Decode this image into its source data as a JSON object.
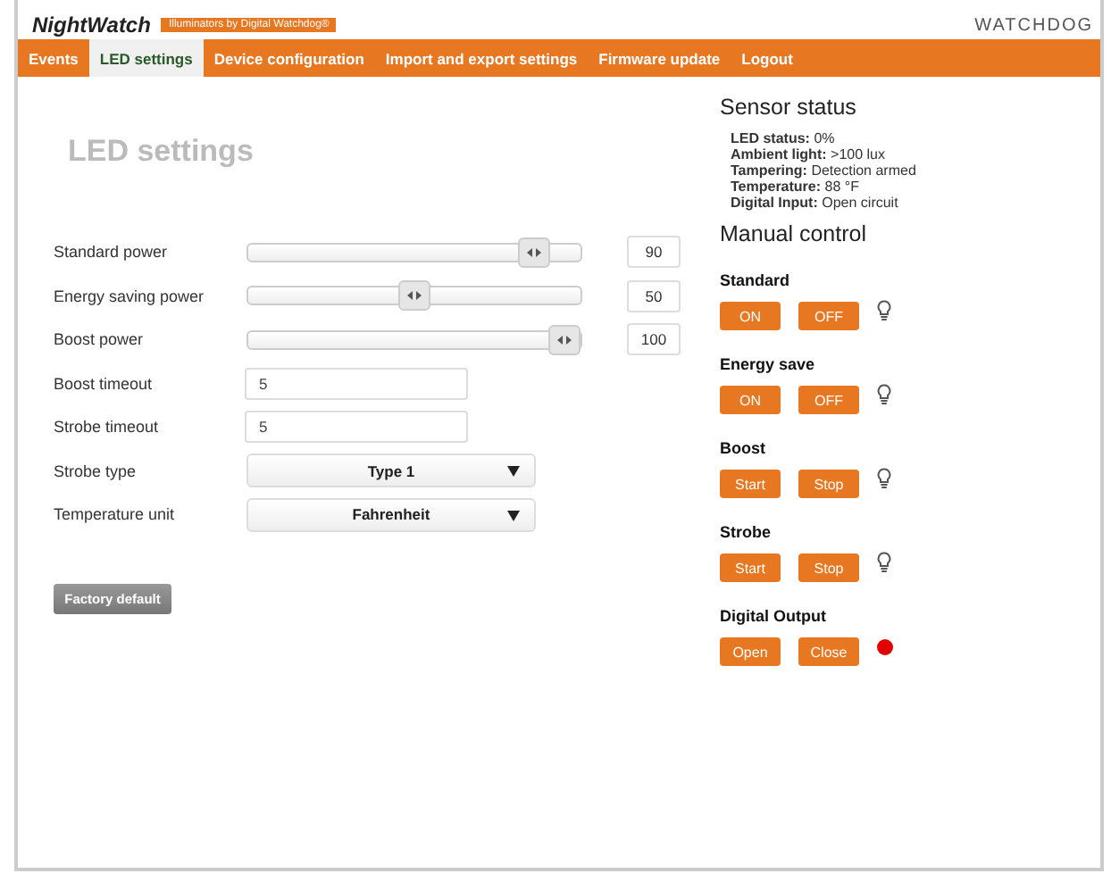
{
  "logo": {
    "name": "NightWatch",
    "tagline": "Illuminators by Digital Watchdog®"
  },
  "brand": "WATCHDOG",
  "tabs": [
    {
      "label": "Events",
      "selected": false
    },
    {
      "label": "LED settings",
      "selected": true
    },
    {
      "label": "Device configuration",
      "selected": false
    },
    {
      "label": "Import and export settings",
      "selected": false
    },
    {
      "label": "Firmware update",
      "selected": false
    },
    {
      "label": "Logout",
      "selected": false
    }
  ],
  "title": "LED settings",
  "settings": [
    {
      "kind": "slider",
      "label": "Standard power",
      "level": 0.9,
      "value": "90"
    },
    {
      "kind": "slider",
      "label": "Energy saving power",
      "level": 0.5,
      "value": "50"
    },
    {
      "kind": "slider",
      "label": "Boost power",
      "level": 1.0,
      "value": "100"
    },
    {
      "kind": "text",
      "label": "Boost timeout",
      "value": "5"
    },
    {
      "kind": "text",
      "label": "Strobe timeout",
      "value": "5"
    },
    {
      "kind": "select",
      "label": "Strobe type",
      "value": "Type 1"
    },
    {
      "kind": "select",
      "label": "Temperature unit",
      "value": "Fahrenheit"
    }
  ],
  "factory_button": "Factory default",
  "sensor_status": {
    "title": "Sensor status",
    "items": [
      {
        "label": "LED status:",
        "value": "0%"
      },
      {
        "label": "Ambient light:",
        "value": ">100 lux"
      },
      {
        "label": "Tampering:",
        "value": "Detection armed"
      },
      {
        "label": "Temperature:",
        "value": "88 °F"
      },
      {
        "label": "Digital Input:",
        "value": "Open circuit"
      }
    ]
  },
  "manual_control": {
    "title": "Manual control",
    "groups": [
      {
        "name": "Standard",
        "buttons": [
          "ON",
          "OFF"
        ],
        "kind": "lamp"
      },
      {
        "name": "Energy save",
        "buttons": [
          "ON",
          "OFF"
        ],
        "kind": "lamp"
      },
      {
        "name": "Boost",
        "buttons": [
          "Start",
          "Stop"
        ],
        "kind": "lamp"
      },
      {
        "name": "Strobe",
        "buttons": [
          "Start",
          "Stop"
        ],
        "kind": "lamp"
      },
      {
        "name": "Digital Output",
        "buttons": [
          "Open",
          "Close"
        ],
        "kind": "output",
        "color": "#e00000"
      }
    ]
  }
}
